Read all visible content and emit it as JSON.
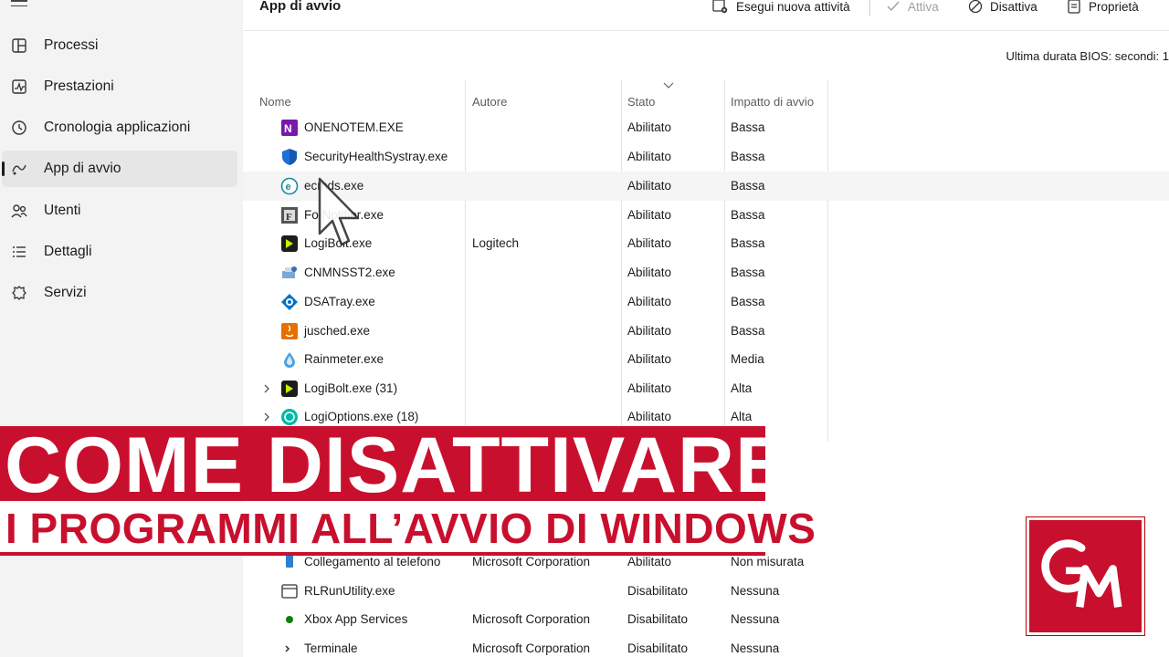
{
  "sidebar": {
    "items": [
      {
        "label": "Processi",
        "icon": "processes-icon"
      },
      {
        "label": "Prestazioni",
        "icon": "performance-icon"
      },
      {
        "label": "Cronologia applicazioni",
        "icon": "history-icon"
      },
      {
        "label": "App di avvio",
        "icon": "startup-apps-icon",
        "active": true
      },
      {
        "label": "Utenti",
        "icon": "users-icon"
      },
      {
        "label": "Dettagli",
        "icon": "details-icon"
      },
      {
        "label": "Servizi",
        "icon": "services-icon"
      }
    ]
  },
  "header": {
    "title": "App di avvio",
    "run_task": "Esegui nuova attività",
    "enable": "Attiva",
    "disable": "Disattiva",
    "properties": "Proprietà"
  },
  "bios": "Ultima durata BIOS:  secondi: 1",
  "columns": {
    "name": "Nome",
    "author": "Autore",
    "state": "Stato",
    "impact": "Impatto di avvio"
  },
  "rows": [
    {
      "name": "ONENOTEM.EXE",
      "author": "",
      "state": "Abilitato",
      "impact": "Bassa",
      "icon": "onenote-icon"
    },
    {
      "name": "SecurityHealthSystray.exe",
      "author": "",
      "state": "Abilitato",
      "impact": "Bassa",
      "icon": "shield-icon"
    },
    {
      "name": "ecmds.exe",
      "author": "",
      "state": "Abilitato",
      "impact": "Bassa",
      "icon": "eset-icon"
    },
    {
      "name": "Fo          Notifier.exe",
      "author": "",
      "state": "Abilitato",
      "impact": "Bassa",
      "icon": "foxit-icon"
    },
    {
      "name": "LogiBolt.exe",
      "author": "Logitech",
      "state": "Abilitato",
      "impact": "Bassa",
      "icon": "logibolt-icon"
    },
    {
      "name": "CNMNSST2.exe",
      "author": "",
      "state": "Abilitato",
      "impact": "Bassa",
      "icon": "canon-icon"
    },
    {
      "name": "DSATray.exe",
      "author": "",
      "state": "Abilitato",
      "impact": "Bassa",
      "icon": "dsa-icon"
    },
    {
      "name": "jusched.exe",
      "author": "",
      "state": "Abilitato",
      "impact": "Bassa",
      "icon": "java-icon"
    },
    {
      "name": "Rainmeter.exe",
      "author": "",
      "state": "Abilitato",
      "impact": "Media",
      "icon": "rainmeter-icon"
    },
    {
      "name": "LogiBolt.exe (31)",
      "author": "",
      "state": "Abilitato",
      "impact": "Alta",
      "icon": "logibolt-icon"
    },
    {
      "name": "LogiOptions.exe (18)",
      "author": "",
      "state": "Abilitato",
      "impact": "Alta",
      "icon": "logioptions-icon"
    },
    {
      "name": "Collegamento al telefono",
      "author": "Microsoft Corporation",
      "state": "Abilitato",
      "impact": "Non misurata",
      "icon": "phone-link-icon"
    },
    {
      "name": "RLRunUtility.exe",
      "author": "",
      "state": "Disabilitato",
      "impact": "Nessuna",
      "icon": "app-window-icon"
    },
    {
      "name": "Xbox App Services",
      "author": "Microsoft Corporation",
      "state": "Disabilitato",
      "impact": "Nessuna",
      "icon": "xbox-icon"
    },
    {
      "name": "Terminale",
      "author": "Microsoft Corporation",
      "state": "Disabilitato",
      "impact": "Nessuna",
      "icon": "terminal-icon"
    }
  ],
  "banner": {
    "line1": "COME DISATTIVARE",
    "line2": "I PROGRAMMI ALL’AVVIO DI WINDOWS"
  },
  "logo": {
    "text": "GM"
  },
  "colors": {
    "accent_red": "#c8102e",
    "sidebar_bg": "#f3f3f3"
  }
}
